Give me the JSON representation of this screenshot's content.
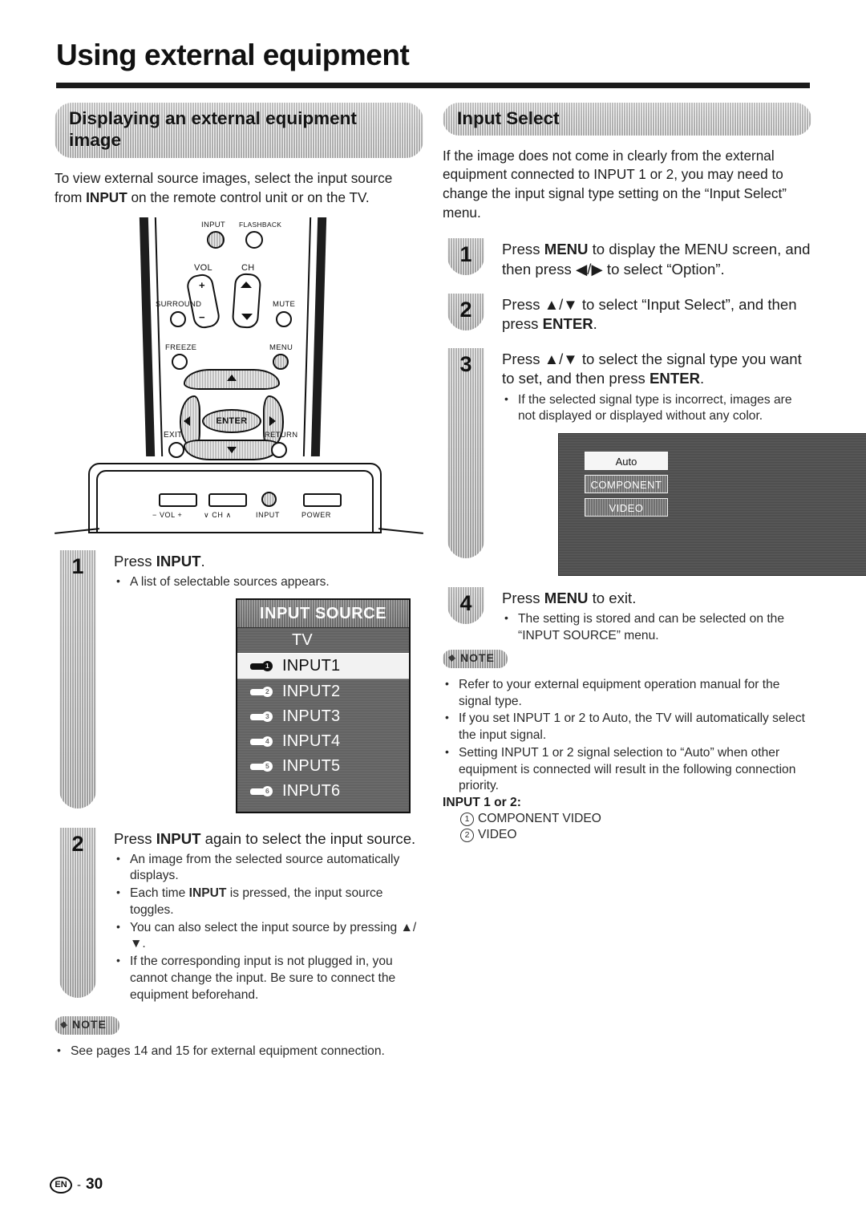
{
  "page": {
    "title": "Using external equipment",
    "footer": {
      "lang": "EN",
      "dash": "-",
      "number": "30"
    }
  },
  "left": {
    "section_title_line1": "Displaying an external equipment",
    "section_title_line2": "image",
    "intro_a": "To view external source images, select the input source from ",
    "intro_b": "INPUT",
    "intro_c": " on the remote control unit or on the TV.",
    "remote": {
      "input_label": "INPUT",
      "flashback_label": "FLASHBACK",
      "vol_label": "VOL",
      "ch_label": "CH",
      "vol_plus": "+",
      "vol_minus": "−",
      "surround_label": "SURROUND",
      "mute_label": "MUTE",
      "freeze_label": "FREEZE",
      "menu_label": "MENU",
      "enter_label": "ENTER",
      "exit_label": "EXIT",
      "return_label": "RETURN"
    },
    "tv_panel": {
      "vol_label": "−  VOL  +",
      "ch_label": "∨  CH  ∧",
      "input_label": "INPUT",
      "power_label": "POWER"
    },
    "step1": {
      "number": "1",
      "title_a": "Press ",
      "title_b": "INPUT",
      "title_c": ".",
      "bullets": [
        "A list of selectable sources appears."
      ]
    },
    "osd_input_source": {
      "header": "INPUT SOURCE",
      "rows": [
        {
          "label": "TV",
          "selected": false,
          "plug": false,
          "plug_num": ""
        },
        {
          "label": "INPUT1",
          "selected": true,
          "plug": true,
          "plug_num": "1"
        },
        {
          "label": "INPUT2",
          "selected": false,
          "plug": true,
          "plug_num": "2"
        },
        {
          "label": "INPUT3",
          "selected": false,
          "plug": true,
          "plug_num": "3"
        },
        {
          "label": "INPUT4",
          "selected": false,
          "plug": true,
          "plug_num": "4"
        },
        {
          "label": "INPUT5",
          "selected": false,
          "plug": true,
          "plug_num": "5"
        },
        {
          "label": "INPUT6",
          "selected": false,
          "plug": true,
          "plug_num": "6"
        }
      ]
    },
    "step2": {
      "number": "2",
      "title_a": "Press ",
      "title_b": "INPUT",
      "title_c": " again to select the input source.",
      "bullets": [
        {
          "pre": "An image from the selected source automatically displays.",
          "bold": "",
          "post": ""
        },
        {
          "pre": "Each time ",
          "bold": "INPUT",
          "post": " is pressed, the input source toggles."
        },
        {
          "pre": "You can also select the input source by pressing ▲/▼.",
          "bold": "",
          "post": ""
        },
        {
          "pre": "If the corresponding input is not plugged in, you cannot change the input. Be sure to connect the equipment beforehand.",
          "bold": "",
          "post": ""
        }
      ]
    },
    "note": {
      "tag": "NOTE",
      "bullets": [
        "See pages 14 and 15 for external equipment connection."
      ]
    }
  },
  "right": {
    "section_title": "Input Select",
    "intro": "If the image does not come in clearly from the external equipment connected to INPUT 1 or 2, you may need to change the input signal type setting on the “Input Select” menu.",
    "step1": {
      "number": "1",
      "title_a": "Press ",
      "title_b": "MENU",
      "title_c": " to display the MENU screen, and then press ◀/▶ to select “Option”."
    },
    "step2": {
      "number": "2",
      "title_a": "Press ▲/▼ to select “Input Select”, and then press ",
      "title_b": "ENTER",
      "title_c": "."
    },
    "step3": {
      "number": "3",
      "title_a": "Press ▲/▼ to select the signal type you want to set, and then press ",
      "title_b": "ENTER",
      "title_c": ".",
      "bullets": [
        "If the selected signal type is incorrect, images are not displayed or displayed without any color."
      ]
    },
    "osd_signal": {
      "options": [
        {
          "label": "Auto",
          "selected": true
        },
        {
          "label": "COMPONENT",
          "selected": false
        },
        {
          "label": "VIDEO",
          "selected": false
        }
      ]
    },
    "step4": {
      "number": "4",
      "title_a": "Press ",
      "title_b": "MENU",
      "title_c": " to exit.",
      "bullets": [
        "The setting is stored and can be selected on the “INPUT SOURCE” menu."
      ]
    },
    "note": {
      "tag": "NOTE",
      "bullets": [
        "Refer to your external equipment operation manual for the signal type.",
        "If you set INPUT 1 or 2 to Auto, the TV will automatically select the input signal.",
        "Setting INPUT 1 or 2 signal selection to “Auto” when other equipment is connected will result in the following connection priority."
      ],
      "priority_title": "INPUT 1 or 2:",
      "priority": [
        {
          "num": "1",
          "label": "COMPONENT VIDEO"
        },
        {
          "num": "2",
          "label": "VIDEO"
        }
      ]
    }
  }
}
